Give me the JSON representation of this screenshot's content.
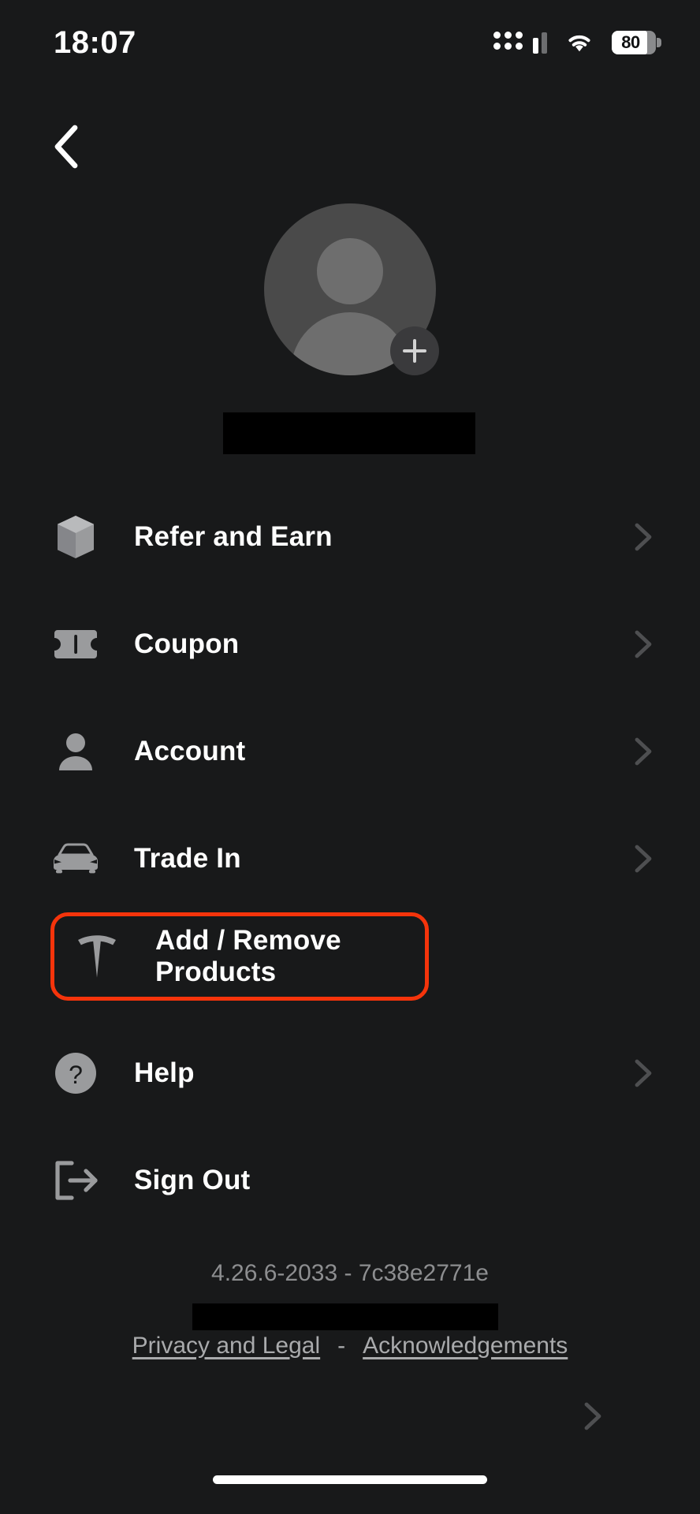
{
  "status_bar": {
    "time": "18:07",
    "signal_icon": "cellular-signal-icon",
    "wifi_icon": "wifi-icon",
    "battery_level": "80",
    "battery_icon": "battery-icon"
  },
  "nav": {
    "back_icon": "chevron-left-icon"
  },
  "profile": {
    "avatar_icon": "person-avatar-icon",
    "add_photo_icon": "plus-icon",
    "name_redacted": true
  },
  "menu": {
    "items": [
      {
        "label": "Refer and Earn",
        "icon": "cube-box-icon",
        "chevron": "chevron-right-icon",
        "highlighted": false
      },
      {
        "label": "Coupon",
        "icon": "ticket-icon",
        "chevron": "chevron-right-icon",
        "highlighted": false
      },
      {
        "label": "Account",
        "icon": "person-icon",
        "chevron": "chevron-right-icon",
        "highlighted": false
      },
      {
        "label": "Trade In",
        "icon": "car-front-icon",
        "chevron": "chevron-right-icon",
        "highlighted": false
      },
      {
        "label": "Add / Remove Products",
        "icon": "tesla-t-icon",
        "chevron": "chevron-right-icon",
        "highlighted": true
      },
      {
        "label": "Help",
        "icon": "question-mark-circle-icon",
        "chevron": "chevron-right-icon",
        "highlighted": false
      },
      {
        "label": "Sign Out",
        "icon": "sign-out-icon",
        "chevron": "",
        "highlighted": false
      }
    ]
  },
  "footer": {
    "version": "4.26.6-2033 - 7c38e2771e",
    "redacted_line": true,
    "privacy_link": "Privacy and Legal",
    "separator": "-",
    "acknowledgements_link": "Acknowledgements"
  },
  "colors": {
    "background": "#18191a",
    "highlight": "#f5340b",
    "icon_gray": "#8d8e90",
    "text_white": "#ffffff",
    "muted_text": "#a9aaac"
  }
}
